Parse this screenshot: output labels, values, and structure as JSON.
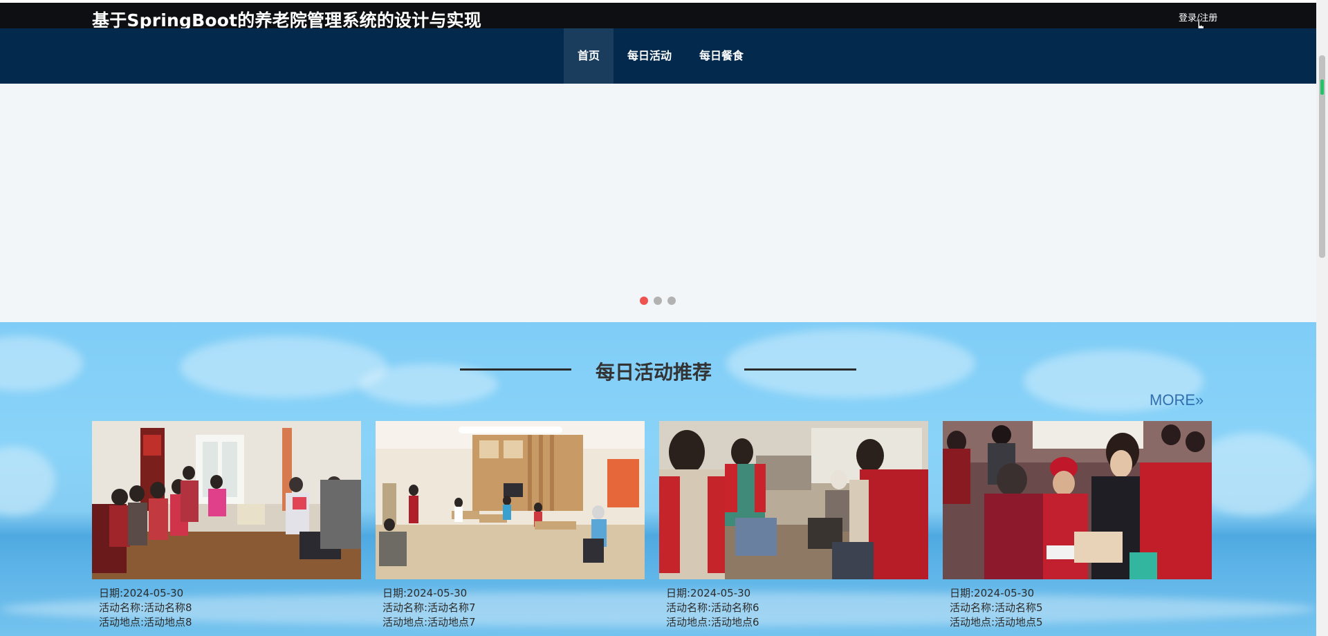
{
  "header": {
    "site_title": "基于SpringBoot的养老院管理系统的设计与实现",
    "login_label": "登录/注册"
  },
  "nav": {
    "items": [
      {
        "label": "首页",
        "active": true
      },
      {
        "label": "每日活动",
        "active": false
      },
      {
        "label": "每日餐食",
        "active": false
      }
    ]
  },
  "banner": {
    "slide_count": 3,
    "active_slide": 1
  },
  "activities": {
    "title": "每日活动推荐",
    "more_label": "MORE»",
    "cards": [
      {
        "date": "日期:2024-05-30",
        "name": "活动名称:活动名称8",
        "location": "活动地点:活动地点8"
      },
      {
        "date": "日期:2024-05-30",
        "name": "活动名称:活动名称7",
        "location": "活动地点:活动地点7"
      },
      {
        "date": "日期:2024-05-30",
        "name": "活动名称:活动名称6",
        "location": "活动地点:活动地点6"
      },
      {
        "date": "日期:2024-05-30",
        "name": "活动名称:活动名称5",
        "location": "活动地点:活动地点5"
      }
    ]
  },
  "colors": {
    "topbar": "#0e0f12",
    "navbar": "#032a4d",
    "nav_active": "#1a3d5e",
    "dot_active": "#ef5350",
    "dot_inactive": "#b2b2b2",
    "more_link": "#2f6fae"
  }
}
